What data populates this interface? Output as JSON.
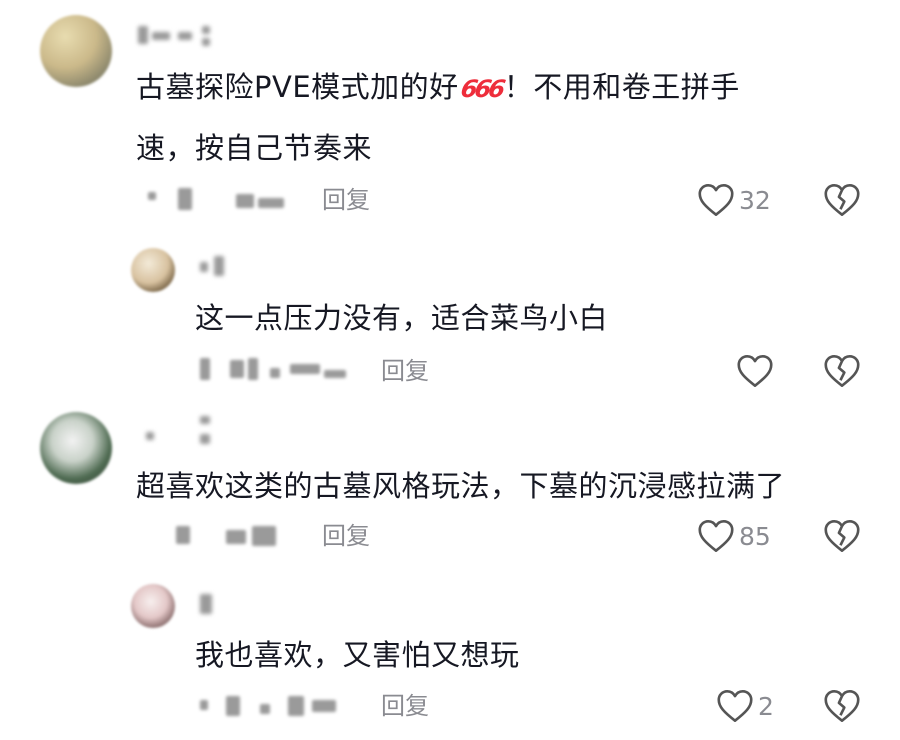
{
  "comments": [
    {
      "text_parts": [
        "古墓探险PVE模式加的好",
        "666",
        "！不用和卷王拼手"
      ],
      "text_line2": "速，按自己节奏来",
      "reply_label": "回复",
      "likes": "32",
      "icons": {
        "like": "heart-outline-icon",
        "dislike": "broken-heart-icon"
      }
    },
    {
      "text": "这一点压力没有，适合菜鸟小白",
      "reply_label": "回复",
      "likes": "",
      "icons": {
        "like": "heart-outline-icon",
        "dislike": "broken-heart-icon"
      }
    },
    {
      "text": "超喜欢这类的古墓风格玩法，下墓的沉浸感拉满了",
      "reply_label": "回复",
      "likes": "85",
      "icons": {
        "like": "heart-outline-icon",
        "dislike": "broken-heart-icon"
      }
    },
    {
      "text": "我也喜欢，又害怕又想玩",
      "reply_label": "回复",
      "likes": "2",
      "icons": {
        "like": "heart-outline-icon",
        "dislike": "broken-heart-icon"
      }
    }
  ],
  "colors": {
    "text": "#161823",
    "muted": "#8a8b91",
    "emoji_red": "#ee2d3b"
  }
}
